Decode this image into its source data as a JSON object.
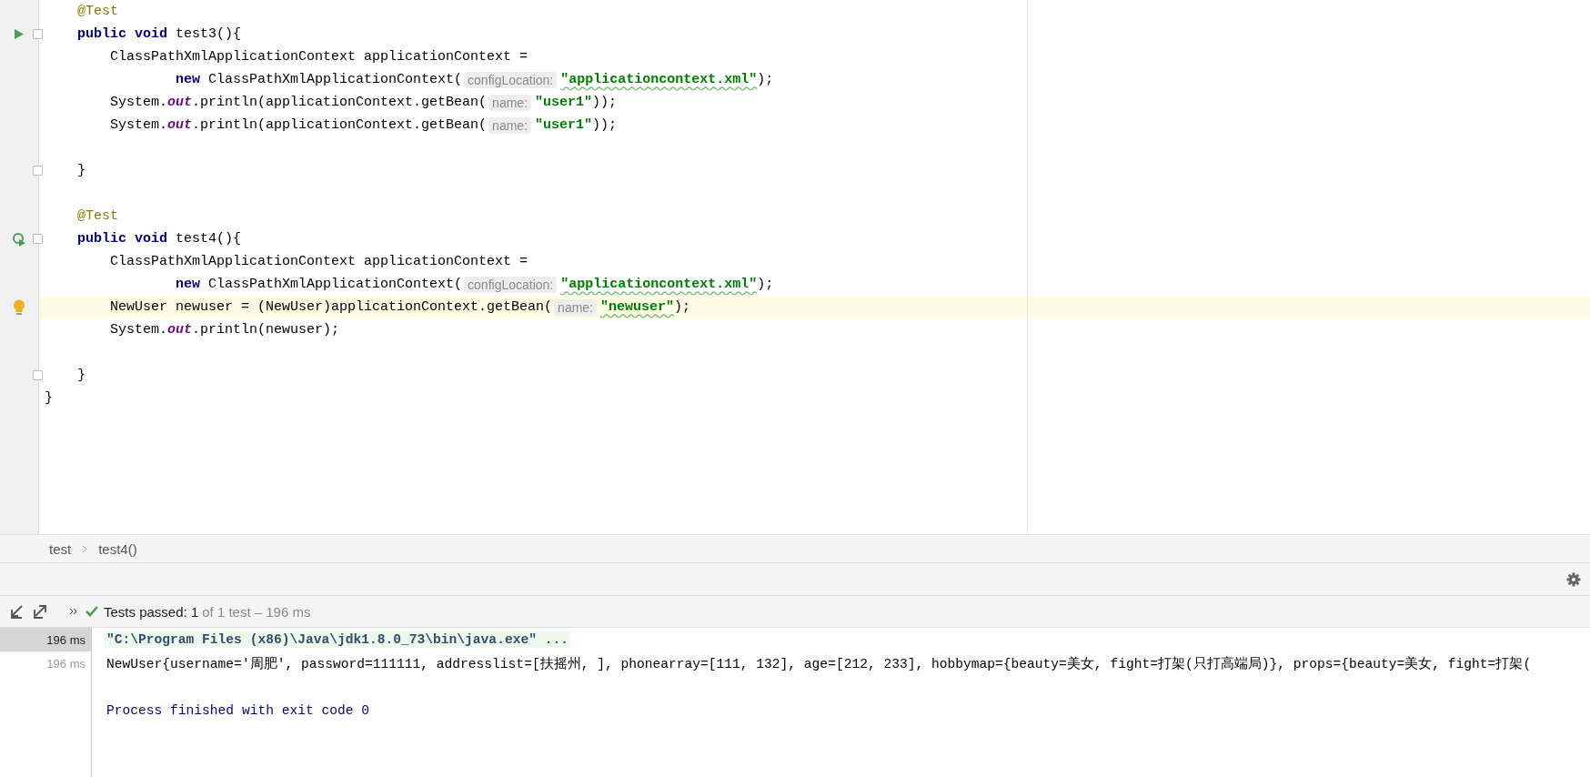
{
  "editor": {
    "lines": [
      {
        "fold": false,
        "current": false,
        "tokens": [
          {
            "kind": "annotation",
            "text": "    @Test"
          }
        ]
      },
      {
        "gutter": {
          "kind": "run"
        },
        "fold": true,
        "current": false,
        "tokens": [
          {
            "kind": "keyword",
            "text": "    public void "
          },
          {
            "kind": "plain",
            "text": "test3(){"
          }
        ]
      },
      {
        "fold": false,
        "current": false,
        "tokens": [
          {
            "kind": "plain",
            "text": "        ClassPathXmlApplicationContext applicationContext ="
          }
        ]
      },
      {
        "fold": false,
        "current": false,
        "tokens": [
          {
            "kind": "keyword",
            "text": "                new "
          },
          {
            "kind": "plain",
            "text": "ClassPathXmlApplicationContext("
          },
          {
            "kind": "hint",
            "text": "configLocation:"
          },
          {
            "kind": "string",
            "text": "\"applicationcontext.xml\"",
            "squiggle": true
          },
          {
            "kind": "plain",
            "text": ");"
          }
        ]
      },
      {
        "fold": false,
        "current": false,
        "tokens": [
          {
            "kind": "plain",
            "text": "        System."
          },
          {
            "kind": "static",
            "text": "out"
          },
          {
            "kind": "plain",
            "text": ".println(applicationContext.getBean("
          },
          {
            "kind": "hint",
            "text": "name:"
          },
          {
            "kind": "string",
            "text": "\"user1\"",
            "squiggle": false
          },
          {
            "kind": "plain",
            "text": "));"
          }
        ]
      },
      {
        "fold": false,
        "current": false,
        "tokens": [
          {
            "kind": "plain",
            "text": "        System."
          },
          {
            "kind": "static",
            "text": "out"
          },
          {
            "kind": "plain",
            "text": ".println(applicationContext.getBean("
          },
          {
            "kind": "hint",
            "text": "name:"
          },
          {
            "kind": "string",
            "text": "\"user1\"",
            "squiggle": false
          },
          {
            "kind": "plain",
            "text": "));"
          }
        ]
      },
      {
        "fold": false,
        "current": false
      },
      {
        "fold": true,
        "current": false,
        "tokens": [
          {
            "kind": "plain",
            "text": "    }"
          }
        ]
      },
      {
        "fold": false,
        "current": false
      },
      {
        "fold": false,
        "current": false,
        "tokens": [
          {
            "kind": "annotation",
            "text": "    @Test"
          }
        ]
      },
      {
        "gutter": {
          "kind": "rerun"
        },
        "fold": true,
        "current": false,
        "tokens": [
          {
            "kind": "keyword",
            "text": "    public void "
          },
          {
            "kind": "plain",
            "text": "test4(){"
          }
        ]
      },
      {
        "fold": false,
        "current": false,
        "tokens": [
          {
            "kind": "plain",
            "text": "        ClassPathXmlApplicationContext applicationContext ="
          }
        ]
      },
      {
        "fold": false,
        "current": false,
        "tokens": [
          {
            "kind": "keyword",
            "text": "                new "
          },
          {
            "kind": "plain",
            "text": "ClassPathXmlApplicationContext("
          },
          {
            "kind": "hint",
            "text": "configLocation:"
          },
          {
            "kind": "string",
            "text": "\"applicationcontext.xml\"",
            "squiggle": true
          },
          {
            "kind": "plain",
            "text": ");"
          }
        ]
      },
      {
        "gutter": {
          "kind": "bulb"
        },
        "fold": false,
        "current": true,
        "tokens": [
          {
            "kind": "plain",
            "text": "        NewUser newuser = (NewUser)applicationContext.getBean("
          },
          {
            "kind": "hint",
            "text": "name:"
          },
          {
            "kind": "string",
            "text": "\"newuser\"",
            "squiggle": true
          },
          {
            "kind": "plain",
            "text": ");"
          }
        ]
      },
      {
        "fold": false,
        "current": false,
        "tokens": [
          {
            "kind": "plain",
            "text": "        System."
          },
          {
            "kind": "static",
            "text": "out"
          },
          {
            "kind": "plain",
            "text": ".println(newuser);"
          }
        ]
      },
      {
        "fold": false,
        "current": false
      },
      {
        "fold": true,
        "current": false,
        "tokens": [
          {
            "kind": "plain",
            "text": "    }"
          }
        ]
      },
      {
        "fold": false,
        "current": false,
        "tokens": [
          {
            "kind": "plain",
            "text": "}"
          }
        ]
      }
    ]
  },
  "breadcrumb": [
    "test",
    "test4()"
  ],
  "run_panel": {
    "status": "Tests passed: 1",
    "detail": "of 1 test – 196 ms",
    "rows": [
      {
        "time": "196 ms",
        "selected": true,
        "kind": "command",
        "text": "\"C:\\Program Files (x86)\\Java\\jdk1.8.0_73\\bin\\java.exe\" ..."
      },
      {
        "time": "196 ms",
        "selected": false,
        "kind": "output",
        "text": "NewUser{username='周肥', password=111111, addresslist=[扶摇州, ], phonearray=[111, 132], age=[212, 233], hobbymap={beauty=美女, fight=打架(只打高端局)}, props={beauty=美女, fight=打架("
      },
      {
        "selected": false,
        "kind": "exit",
        "text": "Process finished with exit code 0"
      }
    ]
  }
}
